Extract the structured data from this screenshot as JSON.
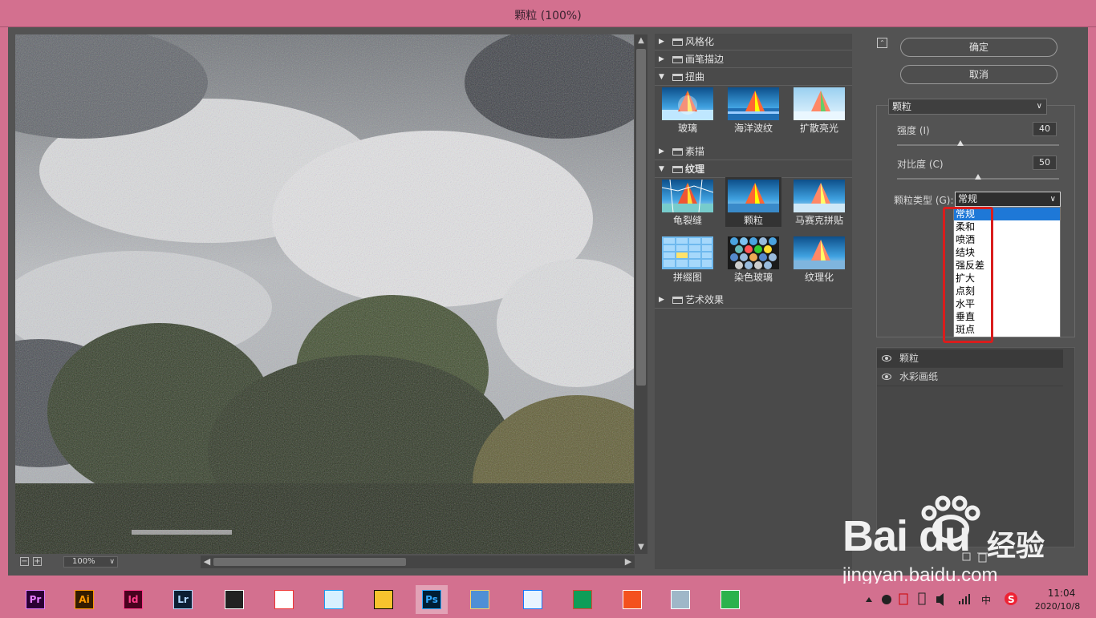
{
  "window": {
    "title": "颗粒 (100%)"
  },
  "preview": {
    "zoom": "100%",
    "zoom_out": "−",
    "zoom_in": "+"
  },
  "gallery": {
    "categories": [
      {
        "label": "风格化",
        "expanded": false
      },
      {
        "label": "画笔描边",
        "expanded": false
      },
      {
        "label": "扭曲",
        "expanded": true
      },
      {
        "label": "素描",
        "expanded": false
      },
      {
        "label": "纹理",
        "expanded": true
      },
      {
        "label": "艺术效果",
        "expanded": false
      }
    ],
    "distort_filters": [
      "玻璃",
      "海洋波纹",
      "扩散亮光"
    ],
    "texture_filters": [
      "龟裂缝",
      "颗粒",
      "马赛克拼贴",
      "拼缀图",
      "染色玻璃",
      "纹理化"
    ],
    "selected_filter": "颗粒"
  },
  "controls": {
    "ok": "确定",
    "cancel": "取消",
    "filter_select": "颗粒",
    "intensity_label": "强度 (I)",
    "intensity_value": "40",
    "intensity_level": 0.4,
    "contrast_label": "对比度 (C)",
    "contrast_value": "50",
    "contrast_level": 0.5,
    "grain_type_label": "颗粒类型 (G):",
    "grain_type_value": "常规",
    "grain_type_options": [
      "常规",
      "柔和",
      "喷洒",
      "结块",
      "强反差",
      "扩大",
      "点刻",
      "水平",
      "垂直",
      "斑点"
    ]
  },
  "layers": [
    {
      "name": "颗粒",
      "active": true
    },
    {
      "name": "水彩画纸",
      "active": false
    }
  ],
  "taskbar": {
    "apps": [
      {
        "name": "Pr",
        "color": "#e77cff",
        "bg": "#2a0033"
      },
      {
        "name": "Ai",
        "color": "#ff9a00",
        "bg": "#331c00"
      },
      {
        "name": "Id",
        "color": "#ff3d8b",
        "bg": "#49021f"
      },
      {
        "name": "Lr",
        "color": "#b1d8ff",
        "bg": "#0b1f33"
      },
      {
        "name": "",
        "color": "#ffffff",
        "bg": "#222222"
      },
      {
        "name": "",
        "color": "#e33",
        "bg": "#ffffff"
      },
      {
        "name": "",
        "color": "#1d9bf0",
        "bg": "#d7f0ff"
      },
      {
        "name": "",
        "color": "#000",
        "bg": "#f7c32e"
      },
      {
        "name": "Ps",
        "color": "#31a8ff",
        "bg": "#001e36"
      },
      {
        "name": "",
        "color": "#f7d26a",
        "bg": "#4f8fd6"
      },
      {
        "name": "",
        "color": "#1677ff",
        "bg": "#e8f4ff"
      },
      {
        "name": "",
        "color": "#db4437",
        "bg": "#0f9d58"
      },
      {
        "name": "",
        "color": "#fff",
        "bg": "#f4511e"
      },
      {
        "name": "",
        "color": "#fff",
        "bg": "#9fb7c8"
      },
      {
        "name": "",
        "color": "#fff",
        "bg": "#2bb24c"
      }
    ],
    "time": "11:04",
    "date": "2020/10/8",
    "ime": "中"
  },
  "watermark": {
    "brand": "Bai du",
    "brand_cn": "经验",
    "url": "jingyan.baidu.com"
  }
}
